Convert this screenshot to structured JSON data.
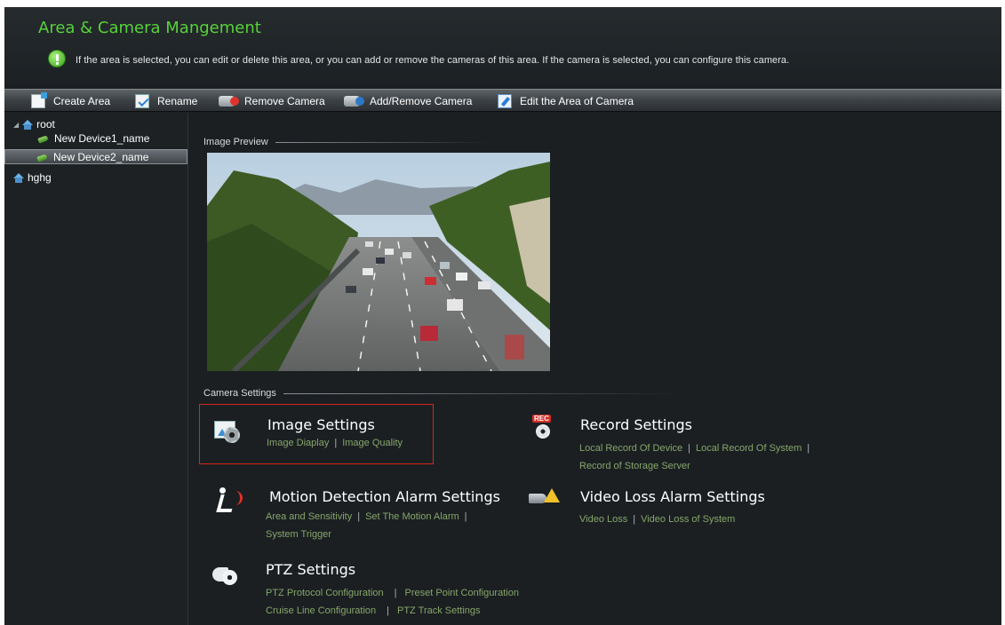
{
  "header": {
    "title": "Area & Camera Mangement",
    "tip": "If the area is selected, you can edit or delete this area, or you can add or remove the cameras of this area. If the camera is selected, you can configure this camera."
  },
  "toolbar": {
    "create_area": "Create Area",
    "rename": "Rename",
    "remove_camera": "Remove Camera",
    "add_remove_camera": "Add/Remove Camera",
    "edit_area_of_camera": "Edit the Area of Camera"
  },
  "tree": {
    "root": "root",
    "device1": "New Device1_name",
    "device2": "New Device2_name",
    "area2": "hghg",
    "selected": "New Device2_name"
  },
  "main": {
    "image_preview_label": "Image Preview",
    "camera_settings_label": "Camera Settings",
    "image_settings": {
      "title": "Image Settings",
      "links": [
        "Image Diaplay",
        "Image Quality"
      ]
    },
    "record_settings": {
      "title": "Record Settings",
      "links": [
        "Local Record Of Device",
        "Local Record Of System",
        "Record of Storage Server"
      ]
    },
    "motion_settings": {
      "title": "Motion Detection Alarm Settings",
      "links": [
        "Area and Sensitivity",
        "Set The Motion Alarm",
        "System Trigger"
      ]
    },
    "video_loss_settings": {
      "title": "Video Loss Alarm Settings",
      "links": [
        "Video Loss",
        "Video Loss of System"
      ]
    },
    "ptz_settings": {
      "title": "PTZ Settings",
      "links": [
        "PTZ Protocol Configuration",
        "Preset Point Configuration",
        "Cruise Line Configuration",
        "PTZ Track Settings"
      ]
    }
  },
  "colors": {
    "title_green": "#57d23b",
    "link_green": "#86a66a",
    "highlight_red": "#d6261e",
    "background": "#1b1f22"
  }
}
